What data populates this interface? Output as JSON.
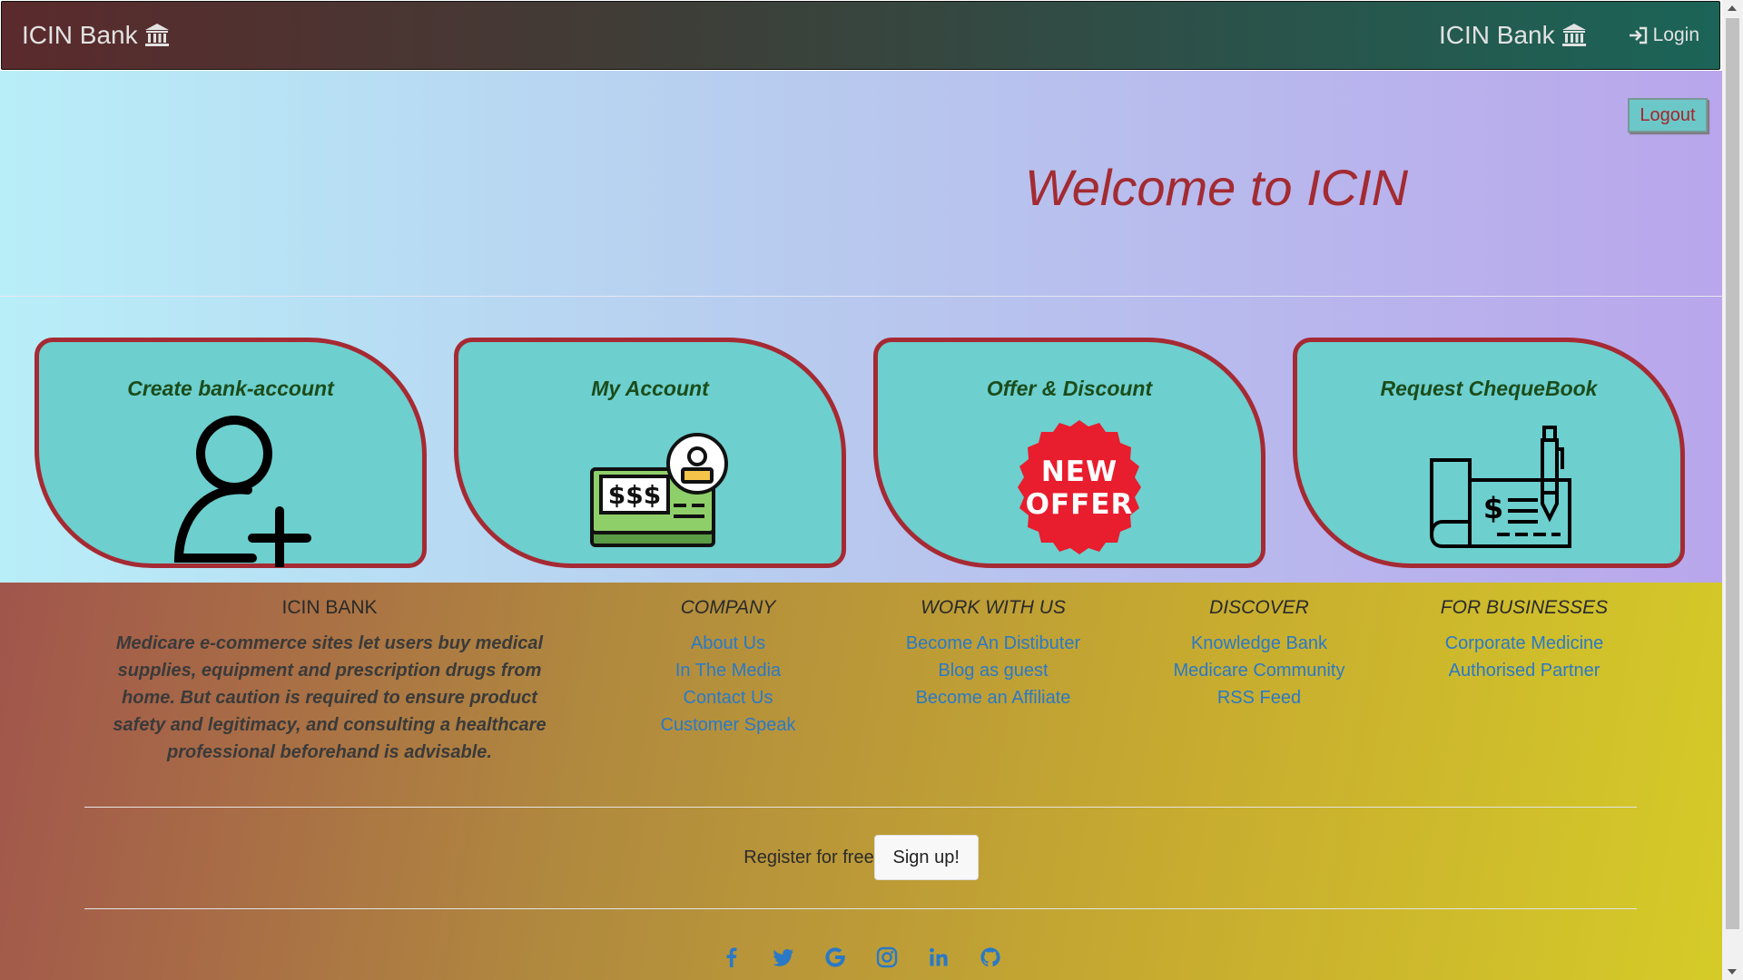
{
  "navbar": {
    "brand": "ICIN Bank",
    "brand_right": "ICIN Bank",
    "login": "Login"
  },
  "hero": {
    "logout": "Logout",
    "welcome": "Welcome to ICIN"
  },
  "cards": [
    {
      "title": "Create bank-account",
      "icon": "add-user-icon"
    },
    {
      "title": "My Account",
      "icon": "account-cheque-icon"
    },
    {
      "title": "Offer & Discount",
      "icon": "new-offer-badge-icon"
    },
    {
      "title": "Request ChequeBook",
      "icon": "chequebook-pen-icon"
    }
  ],
  "offer_badge": {
    "line1": "NEW",
    "line2": "OFFER"
  },
  "footer": {
    "about_title": "ICIN BANK",
    "about_text": "Medicare e-commerce sites let users buy medical supplies, equipment and prescription drugs from home. But caution is required to ensure product safety and legitimacy, and consulting a healthcare professional beforehand is advisable.",
    "columns": [
      {
        "title": "COMPANY",
        "links": [
          "About Us",
          "In The Media",
          "Contact Us",
          "Customer Speak"
        ]
      },
      {
        "title": "WORK WITH US",
        "links": [
          "Become An Distibuter",
          "Blog as guest",
          "Become an Affiliate"
        ]
      },
      {
        "title": "DISCOVER",
        "links": [
          "Knowledge Bank",
          "Medicare Community",
          "RSS Feed"
        ]
      },
      {
        "title": "FOR BUSINESSES",
        "links": [
          "Corporate Medicine",
          "Authorised Partner"
        ]
      }
    ],
    "register_text": "Register for free",
    "signup": "Sign up!",
    "social_icons": [
      "facebook-icon",
      "twitter-icon",
      "google-icon",
      "instagram-icon",
      "linkedin-icon",
      "github-icon"
    ]
  },
  "colors": {
    "accent_red": "#a32b32",
    "card_bg": "#6dcfce",
    "link_blue": "#2a79c6"
  }
}
